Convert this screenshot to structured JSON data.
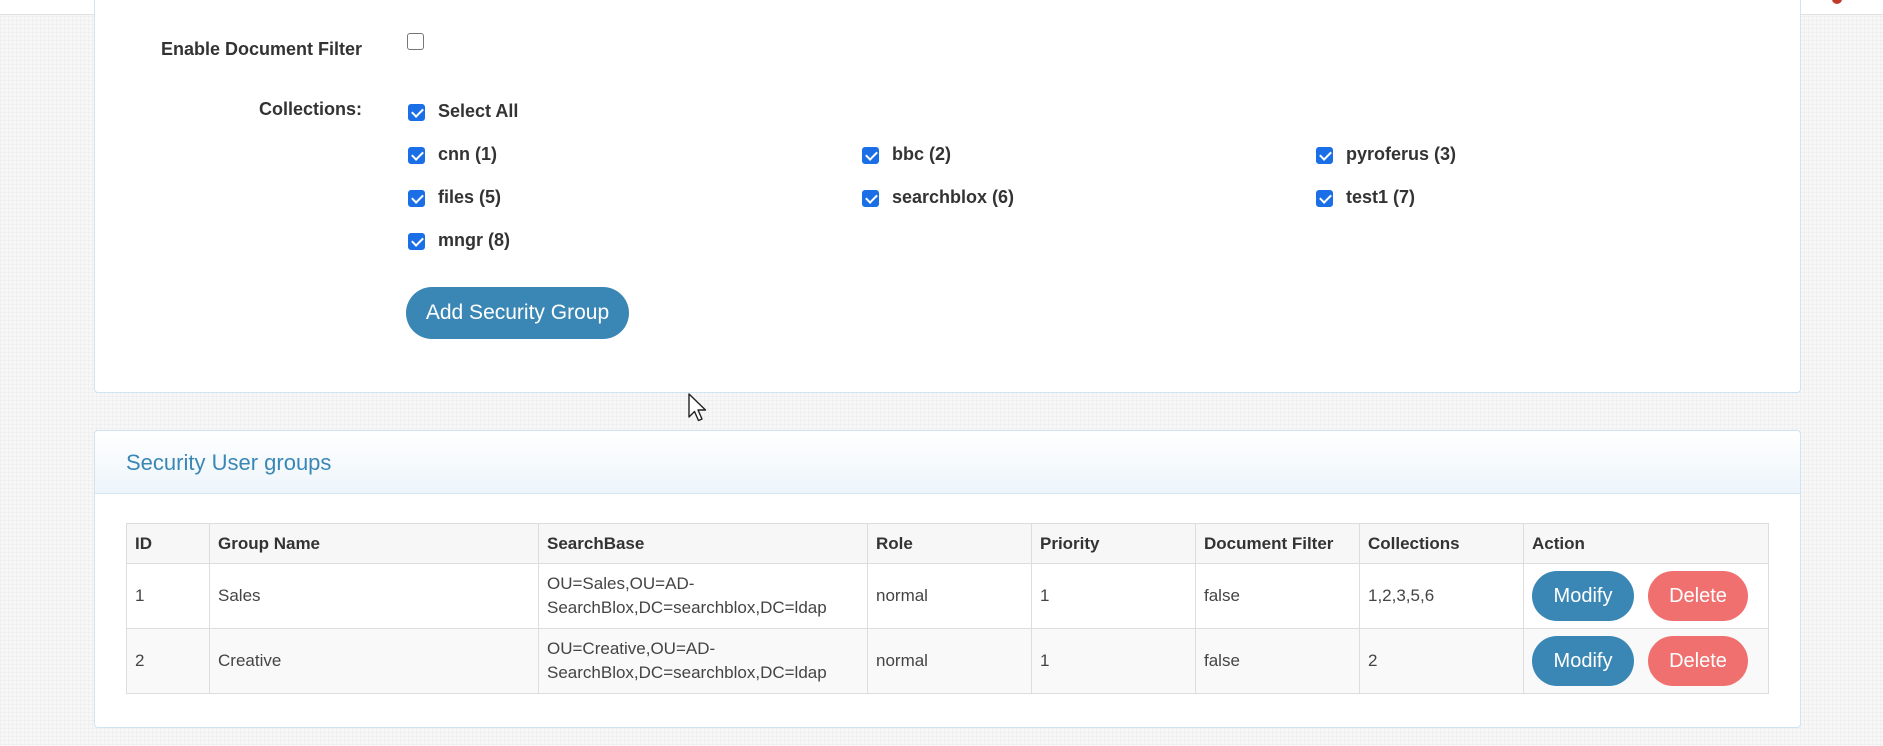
{
  "form": {
    "document_filter_label": "Enable Document Filter",
    "collections_label": "Collections:",
    "select_all_label": "Select All",
    "collections": [
      {
        "label": "cnn (1)",
        "checked": true
      },
      {
        "label": "bbc (2)",
        "checked": true
      },
      {
        "label": "pyroferus (3)",
        "checked": true
      },
      {
        "label": "files (5)",
        "checked": true
      },
      {
        "label": "searchblox (6)",
        "checked": true
      },
      {
        "label": "test1 (7)",
        "checked": true
      },
      {
        "label": "mngr (8)",
        "checked": true
      }
    ],
    "add_button_label": "Add Security Group"
  },
  "groups_panel": {
    "title": "Security User groups",
    "columns": [
      "ID",
      "Group Name",
      "SearchBase",
      "Role",
      "Priority",
      "Document Filter",
      "Collections",
      "Action"
    ],
    "rows": [
      {
        "id": "1",
        "name": "Sales",
        "searchbase": "OU=Sales,OU=AD-SearchBlox,DC=searchblox,DC=ldap",
        "role": "normal",
        "priority": "1",
        "document_filter": "false",
        "collections": "1,2,3,5,6"
      },
      {
        "id": "2",
        "name": "Creative",
        "searchbase": "OU=Creative,OU=AD-SearchBlox,DC=searchblox,DC=ldap",
        "role": "normal",
        "priority": "1",
        "document_filter": "false",
        "collections": "2"
      }
    ],
    "modify_label": "Modify",
    "delete_label": "Delete"
  },
  "colors": {
    "primary": "#3a87b5",
    "danger": "#f07070",
    "checkbox": "#1a6fe6"
  }
}
